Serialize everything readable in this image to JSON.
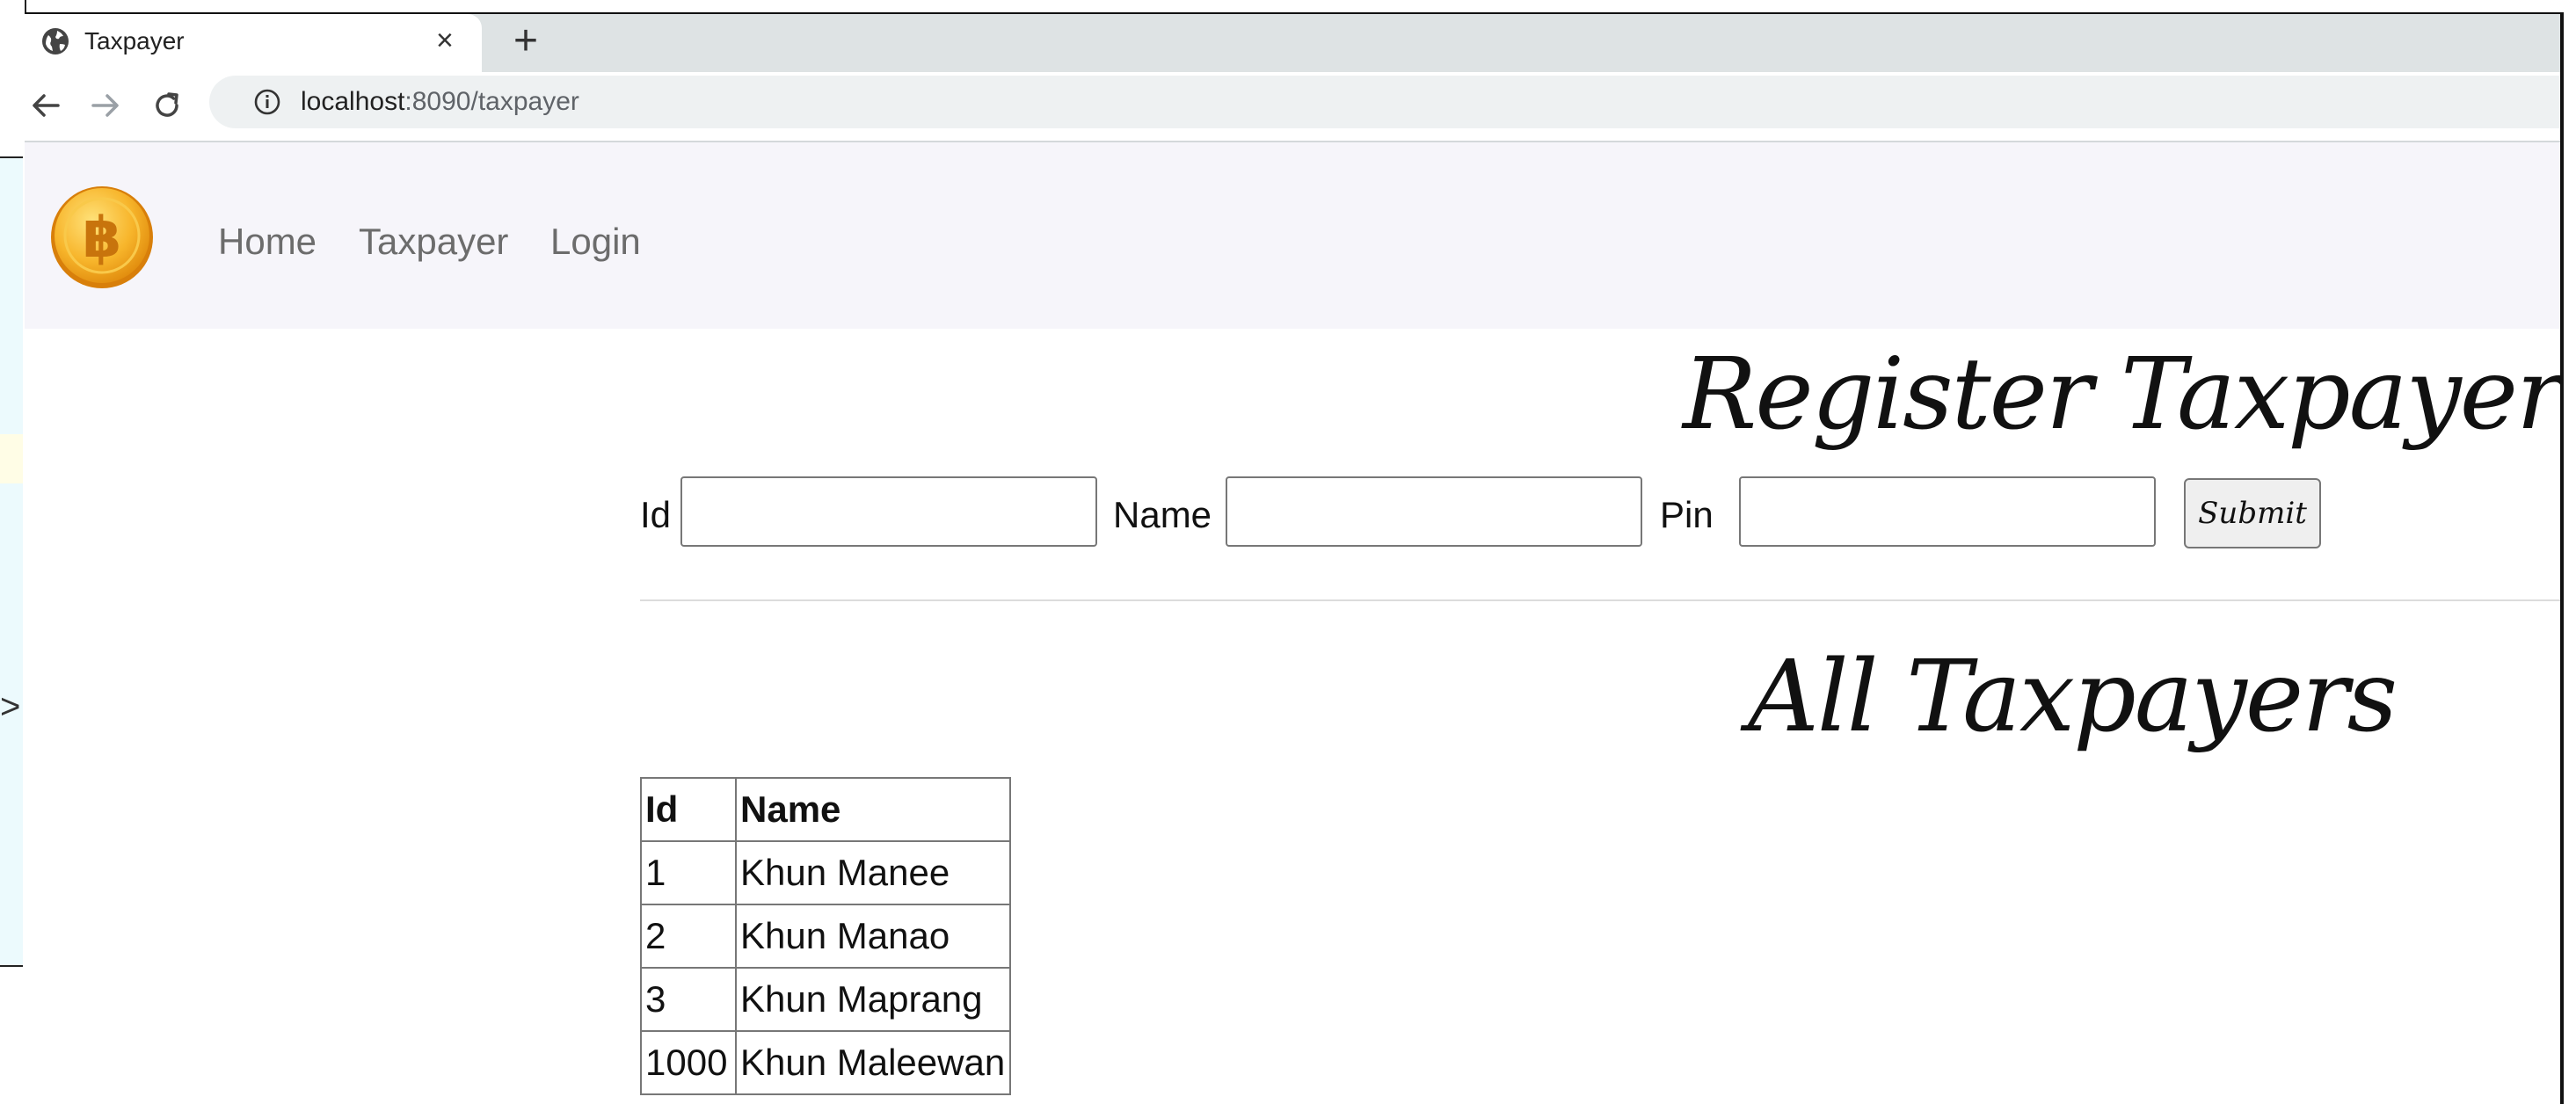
{
  "browser": {
    "tab": {
      "title": "Taxpayer",
      "close_glyph": "×",
      "favicon": "globe-icon"
    },
    "new_tab_glyph": "+",
    "toolbar": {
      "back_icon": "arrow-left-icon",
      "forward_icon": "arrow-right-icon",
      "reload_icon": "reload-icon",
      "url_host": "localhost",
      "url_rest": ":8090/taxpayer"
    }
  },
  "navbar": {
    "logo": "bitcoin-logo-icon",
    "links": [
      {
        "label": "Home"
      },
      {
        "label": "Taxpayer"
      },
      {
        "label": "Login"
      }
    ]
  },
  "register": {
    "title": "Register Taxpayer",
    "fields": {
      "id_label": "Id",
      "id_value": "",
      "name_label": "Name",
      "name_value": "",
      "pin_label": "Pin",
      "pin_value": ""
    },
    "submit_label": "Submit"
  },
  "all_taxpayers": {
    "title": "All Taxpayers",
    "table": {
      "headers": [
        "Id",
        "Name"
      ],
      "rows": [
        [
          "1",
          "Khun Manee"
        ],
        [
          "2",
          "Khun Manao"
        ],
        [
          "3",
          "Khun Maprang"
        ],
        [
          "1000",
          "Khun Maleewan"
        ]
      ]
    }
  },
  "backdrop": {
    "arrow_glyph": ">"
  },
  "colors": {
    "navbar_bg": "#f6f5fa",
    "tab_strip_bg": "#dee3e4",
    "nav_link": "#6c6c6c",
    "logo_gold": "#f5a623"
  }
}
